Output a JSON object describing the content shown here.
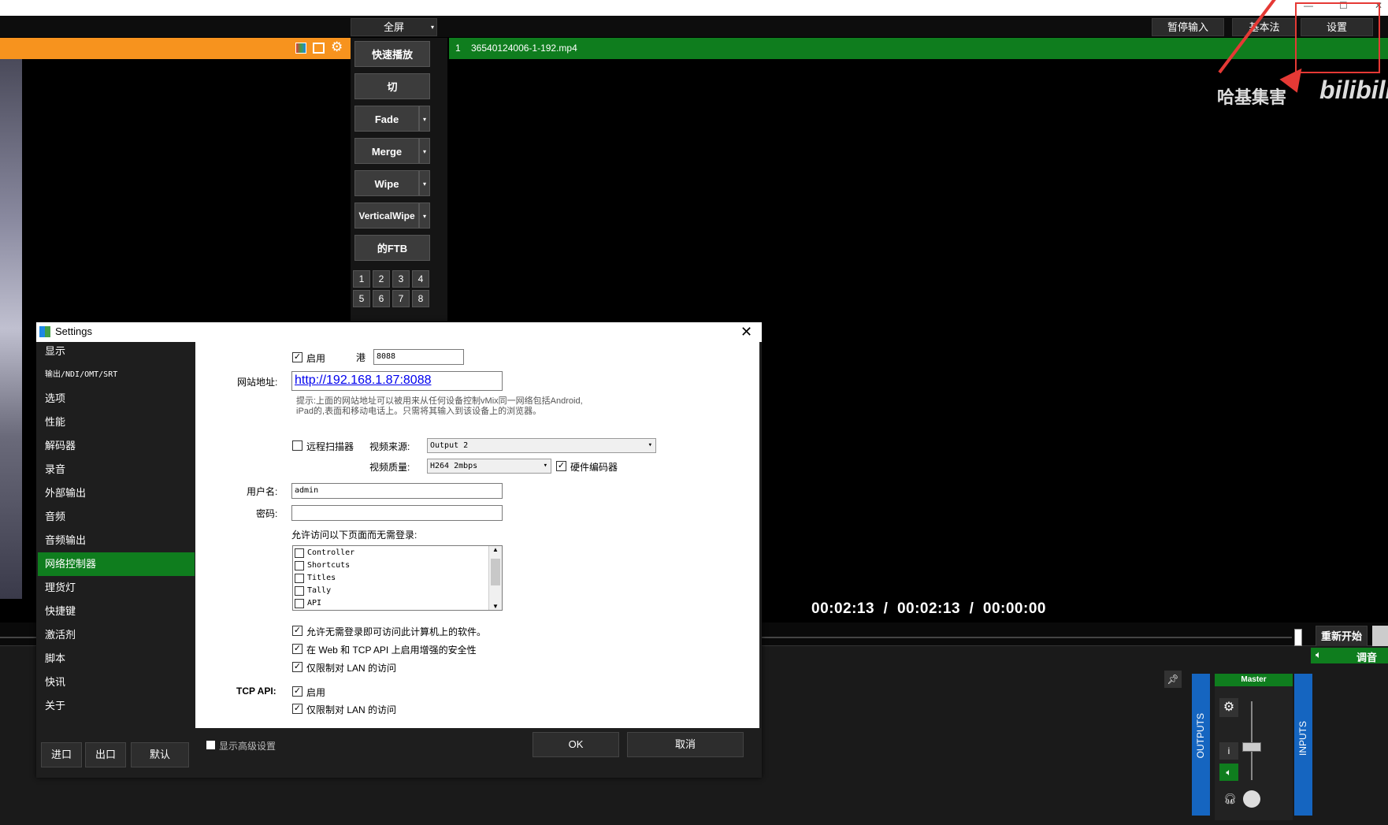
{
  "toolbar": {
    "fullscreen_label": "全屏",
    "pause_input": "暂停输入",
    "basic": "基本法",
    "settings": "设置"
  },
  "green_bar": {
    "index": "1",
    "filename": "36540124006-1-192.mp4"
  },
  "watermark": "哈基集害",
  "transitions": {
    "quick_play": "快速播放",
    "cut": "切",
    "fade": "Fade",
    "merge": "Merge",
    "wipe": "Wipe",
    "vertical_wipe": "VerticalWipe",
    "ftb": "的FTB",
    "numbers": [
      "1",
      "2",
      "3",
      "4",
      "5",
      "6",
      "7",
      "8"
    ]
  },
  "timecode": "00:02:13  /  00:02:13  /  00:00:00",
  "restart_label": "重新开始",
  "audio_label": "调音",
  "mixer": {
    "outputs": "OUTPUTS",
    "inputs": "INPUTS",
    "master": "Master"
  },
  "dialog": {
    "title": "Settings",
    "nav": [
      "显示",
      "输出/NDI/OMT/SRT",
      "选项",
      "性能",
      "解码器",
      "录音",
      "外部输出",
      "音频",
      "音频输出",
      "网络控制器",
      "理货灯",
      "快捷键",
      "激活剂",
      "脚本",
      "快讯",
      "关于"
    ],
    "active_nav": 9,
    "enable_label": "启用",
    "port_label": "港",
    "port_value": "8088",
    "site_label": "网站地址:",
    "site_url": "http://192.168.1.87:8088",
    "hint_line1": "提示:上面的网站地址可以被用来从任何设备控制vMix同一网络包括Android,",
    "hint_line2": "iPad的,表面和移动电话上。只需将其输入到该设备上的浏览器。",
    "remote_scanner": "远程扫描器",
    "video_source_label": "视频来源:",
    "video_source_value": "Output 2",
    "video_quality_label": "视频质量:",
    "video_quality_value": "H264 2mbps",
    "hw_encoder": "硬件编码器",
    "username_label": "用户名:",
    "username_value": "admin",
    "password_label": "密码:",
    "allow_label": "允许访问以下页面而无需登录:",
    "pages": [
      "Controller",
      "Shortcuts",
      "Titles",
      "Tally",
      "API"
    ],
    "opt1": "允许无需登录即可访问此计算机上的软件。",
    "opt2": "在 Web 和 TCP API 上启用增强的安全性",
    "opt3": "仅限制对 LAN 的访问",
    "tcp_label": "TCP API:",
    "tcp_enable": "启用",
    "tcp_lan": "仅限制对 LAN 的访问",
    "import": "进口",
    "export": "出口",
    "default": "默认",
    "advanced": "显示高级设置",
    "ok": "OK",
    "cancel": "取消"
  }
}
